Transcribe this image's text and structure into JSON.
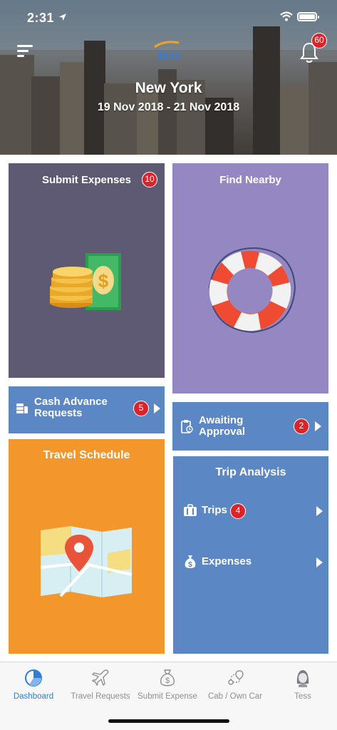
{
  "status_bar": {
    "time": "2:31"
  },
  "header": {
    "logo_text": "tess",
    "notification_count": "60",
    "city": "New York",
    "dates": "19 Nov 2018 - 21 Nov 2018"
  },
  "tiles": {
    "submit_expenses": {
      "title": "Submit Expenses",
      "badge": "10",
      "color": "#5e5a74"
    },
    "find_nearby": {
      "title": "Find Nearby",
      "color": "#9487c2"
    },
    "cash_advance": {
      "title_line1": "Cash Advance",
      "title_line2": "Requests",
      "badge": "5",
      "color": "#5b87c5"
    },
    "awaiting_approval": {
      "title_line1": "Awaiting",
      "title_line2": "Approval",
      "badge": "2",
      "color": "#5b87c5"
    },
    "travel_schedule": {
      "title": "Travel Schedule",
      "color": "#f3962c"
    },
    "trip_analysis": {
      "title": "Trip Analysis",
      "color": "#5b87c5",
      "rows": [
        {
          "label": "Trips",
          "badge": "4",
          "icon": "briefcase-icon"
        },
        {
          "label": "Expenses",
          "icon": "money-bag-icon"
        }
      ]
    }
  },
  "tabbar": {
    "active": "Dashboard",
    "accent": "#2f7fd6",
    "tabs": [
      {
        "label": "Dashboard",
        "icon": "pie-chart-icon"
      },
      {
        "label": "Travel Requests",
        "icon": "airplane-icon"
      },
      {
        "label": "Submit Expense",
        "icon": "money-bag-icon"
      },
      {
        "label": "Cab / Own Car",
        "icon": "route-icon"
      },
      {
        "label": "Tess",
        "icon": "assistant-avatar-icon"
      }
    ]
  }
}
